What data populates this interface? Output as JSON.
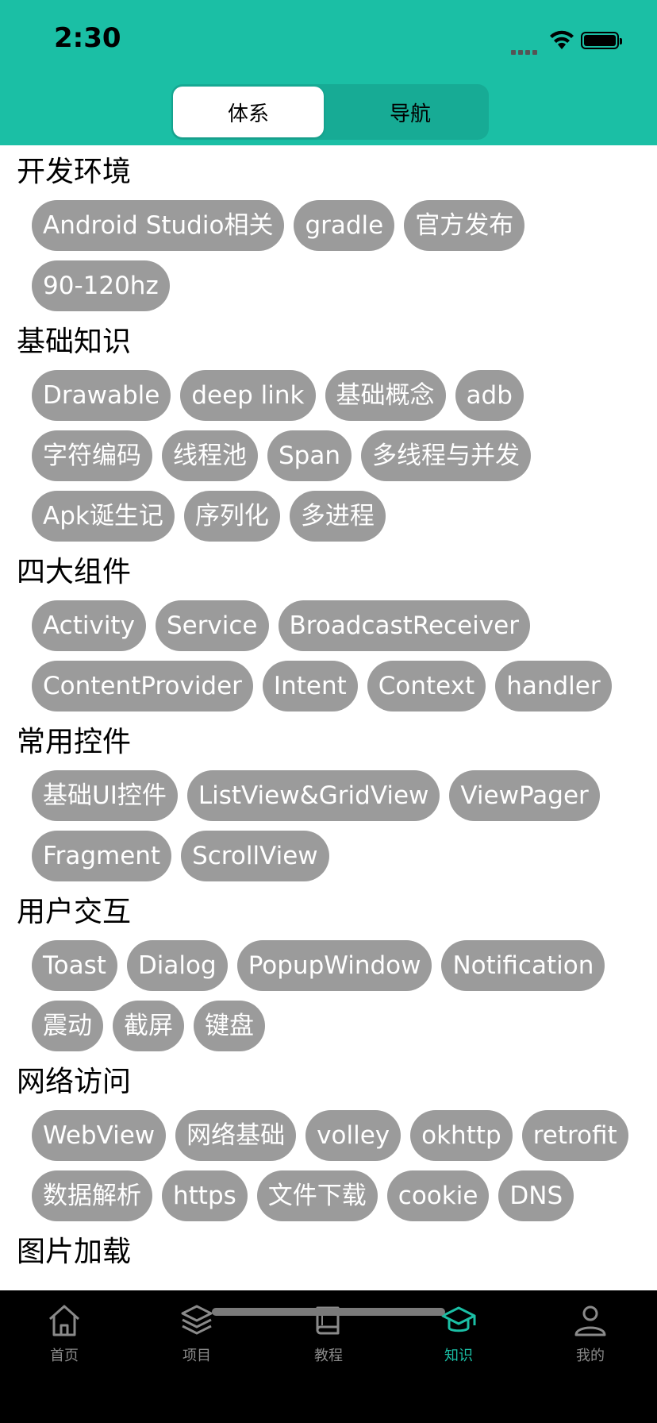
{
  "status": {
    "time": "2:30"
  },
  "segment": {
    "active": "体系",
    "inactive": "导航"
  },
  "sections": [
    {
      "title": "开发环境",
      "tags": [
        "Android Studio相关",
        "gradle",
        "官方发布",
        "90-120hz"
      ]
    },
    {
      "title": "基础知识",
      "tags": [
        "Drawable",
        "deep link",
        "基础概念",
        "adb",
        "字符编码",
        "线程池",
        "Span",
        "多线程与并发",
        "Apk诞生记",
        "序列化",
        "多进程"
      ]
    },
    {
      "title": "四大组件",
      "tags": [
        "Activity",
        "Service",
        "BroadcastReceiver",
        "ContentProvider",
        "Intent",
        "Context",
        "handler"
      ]
    },
    {
      "title": "常用控件",
      "tags": [
        "基础UI控件",
        "ListView&GridView",
        "ViewPager",
        "Fragment",
        "ScrollView"
      ]
    },
    {
      "title": "用户交互",
      "tags": [
        "Toast",
        "Dialog",
        "PopupWindow",
        "Notification",
        "震动",
        "截屏",
        "键盘"
      ]
    },
    {
      "title": "网络访问",
      "tags": [
        "WebView",
        "网络基础",
        "volley",
        "okhttp",
        "retrofit",
        "数据解析",
        "https",
        "文件下载",
        "cookie",
        "DNS"
      ]
    },
    {
      "title": "图片加载",
      "tags": []
    }
  ],
  "tabbar": {
    "items": [
      {
        "label": "首页",
        "icon": "home-icon"
      },
      {
        "label": "项目",
        "icon": "layers-icon"
      },
      {
        "label": "教程",
        "icon": "book-icon"
      },
      {
        "label": "知识",
        "icon": "graduation-cap-icon",
        "active": true
      },
      {
        "label": "我的",
        "icon": "person-icon"
      }
    ]
  },
  "colors": {
    "accent": "#1bbfa5",
    "tag_bg": "#9b9b9b",
    "tabbar_bg": "#000000"
  }
}
